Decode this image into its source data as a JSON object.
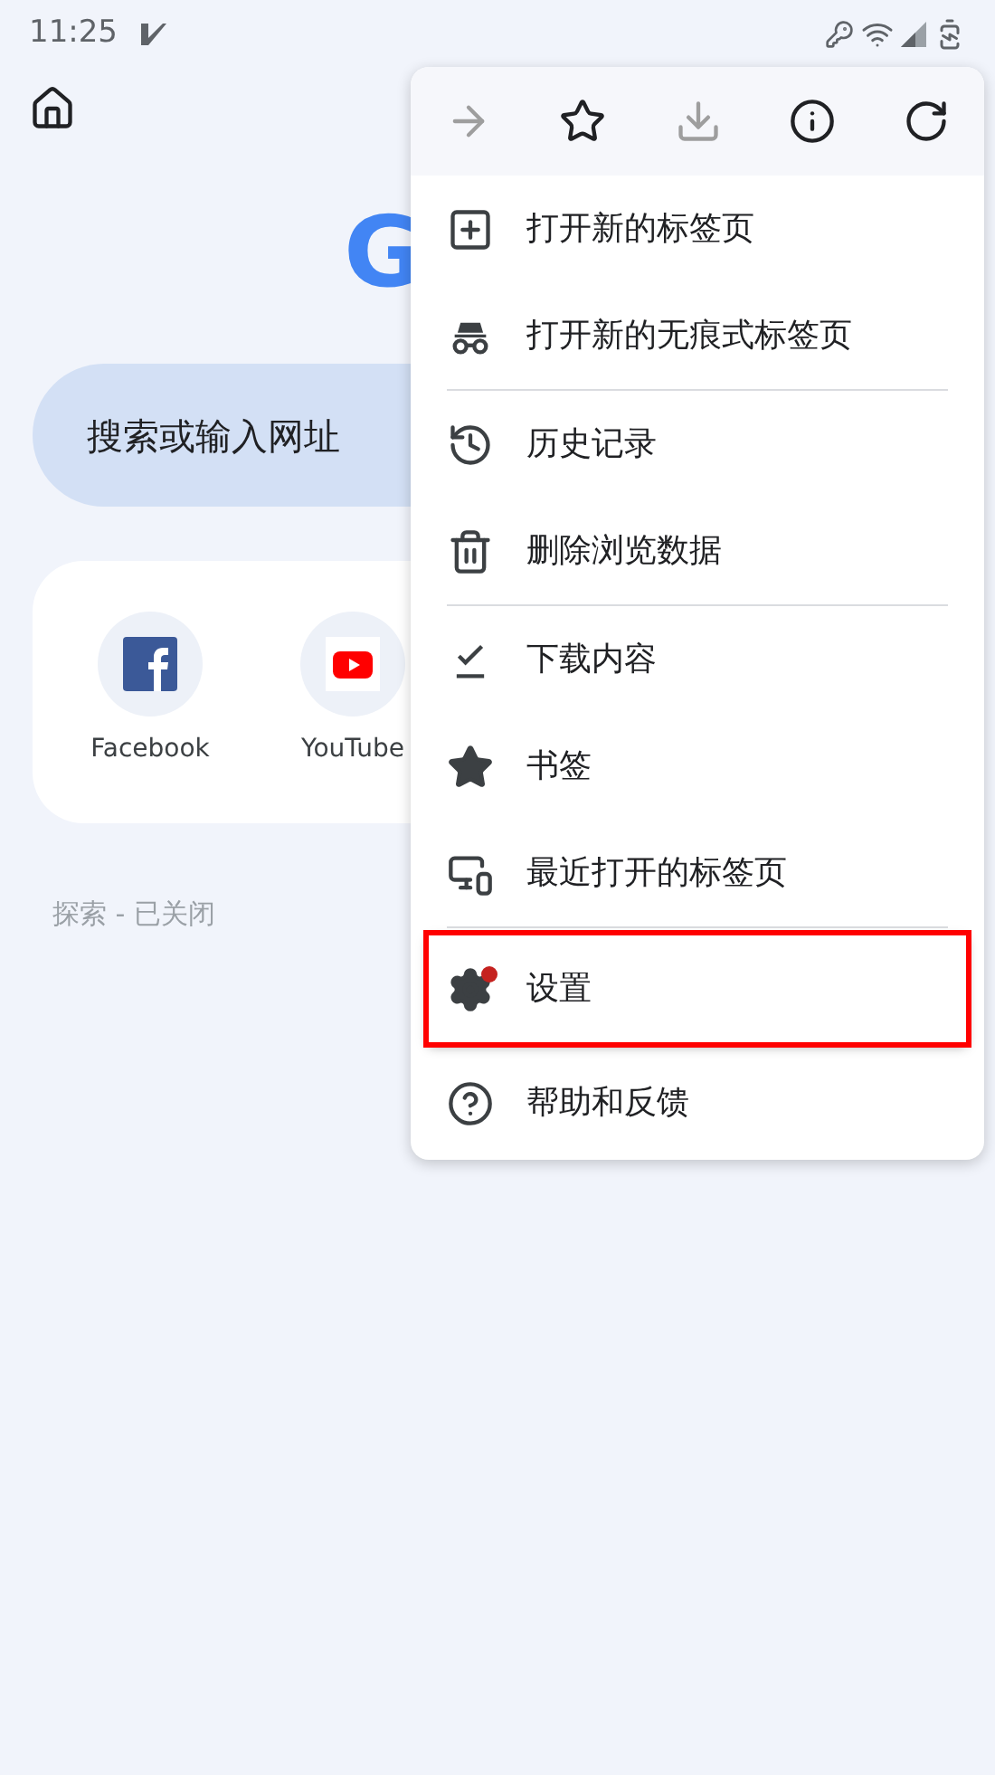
{
  "status_bar": {
    "time": "11:25"
  },
  "logo": {
    "text": "G"
  },
  "search": {
    "placeholder": "搜索或输入网址"
  },
  "shortcuts": [
    {
      "kind": "facebook",
      "label": "Facebook"
    },
    {
      "kind": "youtube",
      "label": "YouTube"
    }
  ],
  "discover": {
    "text": "探索 - 已关闭"
  },
  "menu": {
    "toolbar": [
      {
        "kind": "forward",
        "disabled": true
      },
      {
        "kind": "star",
        "disabled": false
      },
      {
        "kind": "download",
        "disabled": true
      },
      {
        "kind": "info",
        "disabled": false
      },
      {
        "kind": "refresh",
        "disabled": false
      }
    ],
    "groups": [
      [
        {
          "kind": "new-tab",
          "label": "打开新的标签页",
          "highlighted": false
        },
        {
          "kind": "incognito",
          "label": "打开新的无痕式标签页",
          "highlighted": false
        }
      ],
      [
        {
          "kind": "history",
          "label": "历史记录",
          "highlighted": false
        },
        {
          "kind": "delete",
          "label": "删除浏览数据",
          "highlighted": false
        }
      ],
      [
        {
          "kind": "downloads",
          "label": "下载内容",
          "highlighted": false
        },
        {
          "kind": "bookmarks",
          "label": "书签",
          "highlighted": false
        },
        {
          "kind": "recent-tabs",
          "label": "最近打开的标签页",
          "highlighted": false
        }
      ],
      [
        {
          "kind": "settings",
          "label": "设置",
          "highlighted": true,
          "badge": true
        },
        {
          "kind": "help",
          "label": "帮助和反馈",
          "highlighted": false
        }
      ]
    ]
  }
}
